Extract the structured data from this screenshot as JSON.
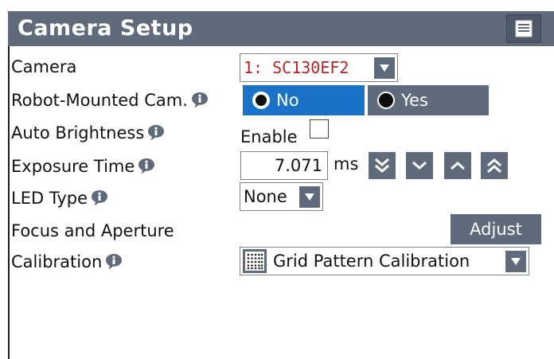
{
  "panel": {
    "title": "Camera Setup",
    "menu_icon": "menu-icon"
  },
  "rows": {
    "camera": {
      "label": "Camera",
      "value": "1: SC130EF2",
      "value_color": "#b02424"
    },
    "robot_mounted": {
      "label": "Robot-Mounted Cam.",
      "options": [
        "No",
        "Yes"
      ],
      "selected": "No"
    },
    "auto_brightness": {
      "label": "Auto Brightness",
      "checkbox_label": "Enable",
      "checked": false
    },
    "exposure": {
      "label": "Exposure Time",
      "value": "7.071",
      "unit": "ms"
    },
    "led_type": {
      "label": "LED Type",
      "value": "None"
    },
    "focus": {
      "label": "Focus and Aperture",
      "button": "Adjust"
    },
    "calibration": {
      "label": "Calibration",
      "value": "Grid Pattern Calibration",
      "icon": "grid-pattern-icon"
    }
  },
  "colors": {
    "accent_blue": "#1a73c6",
    "panel_gray": "#5f6b7a"
  }
}
